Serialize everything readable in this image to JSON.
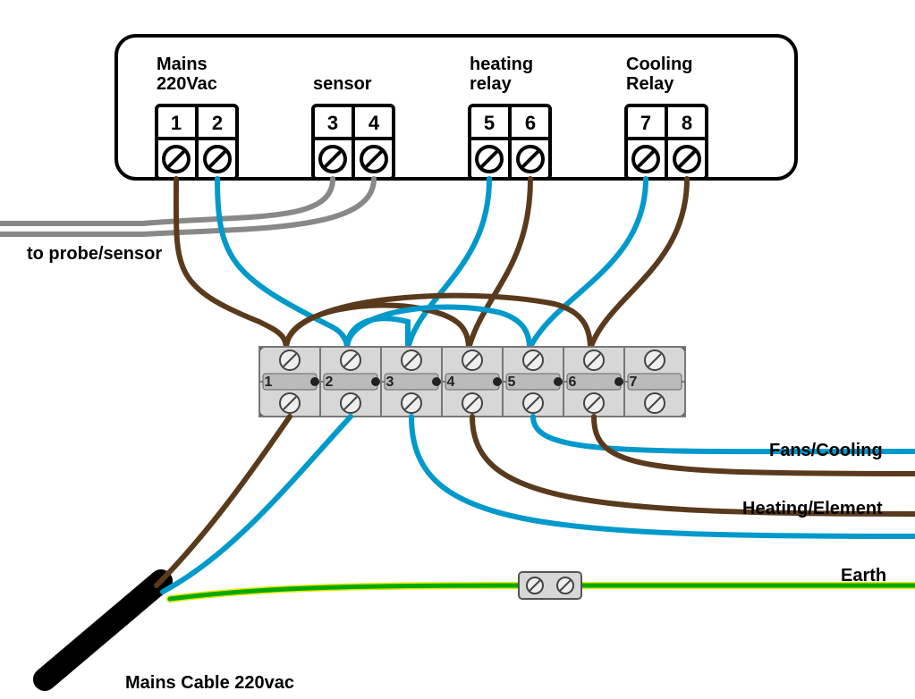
{
  "controller": {
    "groups": [
      {
        "label1": "Mains",
        "label2": "220Vac",
        "terminals": [
          "1",
          "2"
        ]
      },
      {
        "label1": "sensor",
        "label2": "",
        "terminals": [
          "3",
          "4"
        ]
      },
      {
        "label1": "heating",
        "label2": "relay",
        "terminals": [
          "5",
          "6"
        ]
      },
      {
        "label1": "Cooling",
        "label2": "Relay",
        "terminals": [
          "7",
          "8"
        ]
      }
    ]
  },
  "junction_block": {
    "terminals": [
      "1",
      "2",
      "3",
      "4",
      "5",
      "6",
      "7"
    ]
  },
  "labels": {
    "probe": "to probe/sensor",
    "fans": "Fans/Cooling",
    "heating": "Heating/Element",
    "earth": "Earth",
    "mains_cable": "Mains Cable 220vac"
  },
  "wire_colors": {
    "brown": "#5a3a1c",
    "blue": "#0099cc",
    "grey": "#888",
    "yellow": "#e6e600",
    "green": "#00aa00",
    "black": "#000"
  }
}
